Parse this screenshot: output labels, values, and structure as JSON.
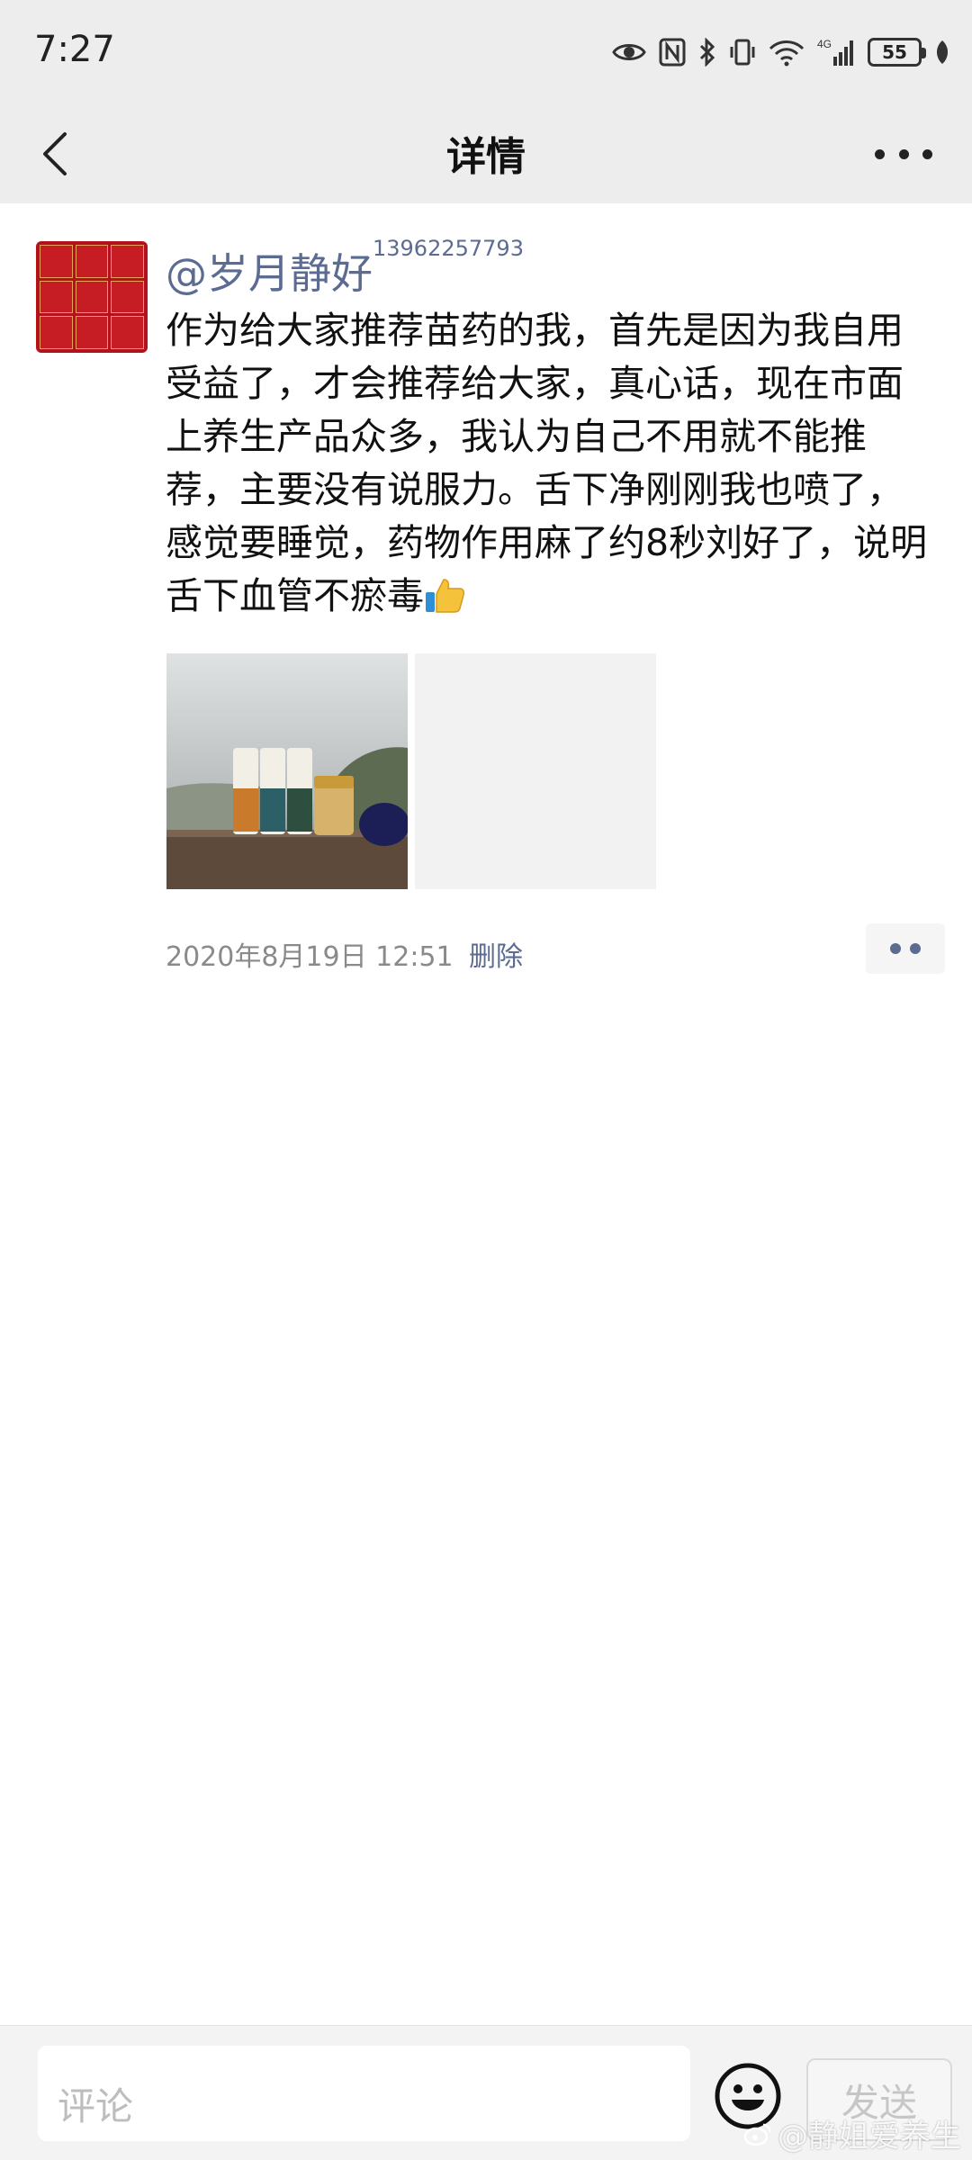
{
  "status_bar": {
    "time": "7:27",
    "battery": "55",
    "icons": [
      "eye-icon",
      "nfc-icon",
      "bluetooth-icon",
      "vibrate-icon",
      "wifi-icon",
      "signal-icon",
      "battery-icon",
      "leaf-icon"
    ],
    "network": "4G"
  },
  "nav": {
    "title": "详情",
    "back_icon": "chevron-left-icon",
    "more_icon": "more-icon"
  },
  "post": {
    "author": "@岁月静好",
    "author_number": "13962257793",
    "content": "作为给大家推荐苗药的我，首先是因为我自用受益了，才会推荐给大家，真心话，现在市面上养生产品众多，我认为自己不用就不能推荐，主要没有说服力。舌下净刚刚我也喷了，感觉要睡觉，药物作用麻了约8秒刘好了，说明舌下血管不瘀毒",
    "time": "2020年8月19日 12:51",
    "delete_label": "删除"
  },
  "composer": {
    "placeholder": "评论",
    "send_label": "发送",
    "emoji_icon": "emoji-icon"
  },
  "watermark": "@静姐爱养生",
  "colors": {
    "bar_bg": "#ededed",
    "link_blue": "#5b6b92",
    "avatar_red": "#b3121c"
  }
}
